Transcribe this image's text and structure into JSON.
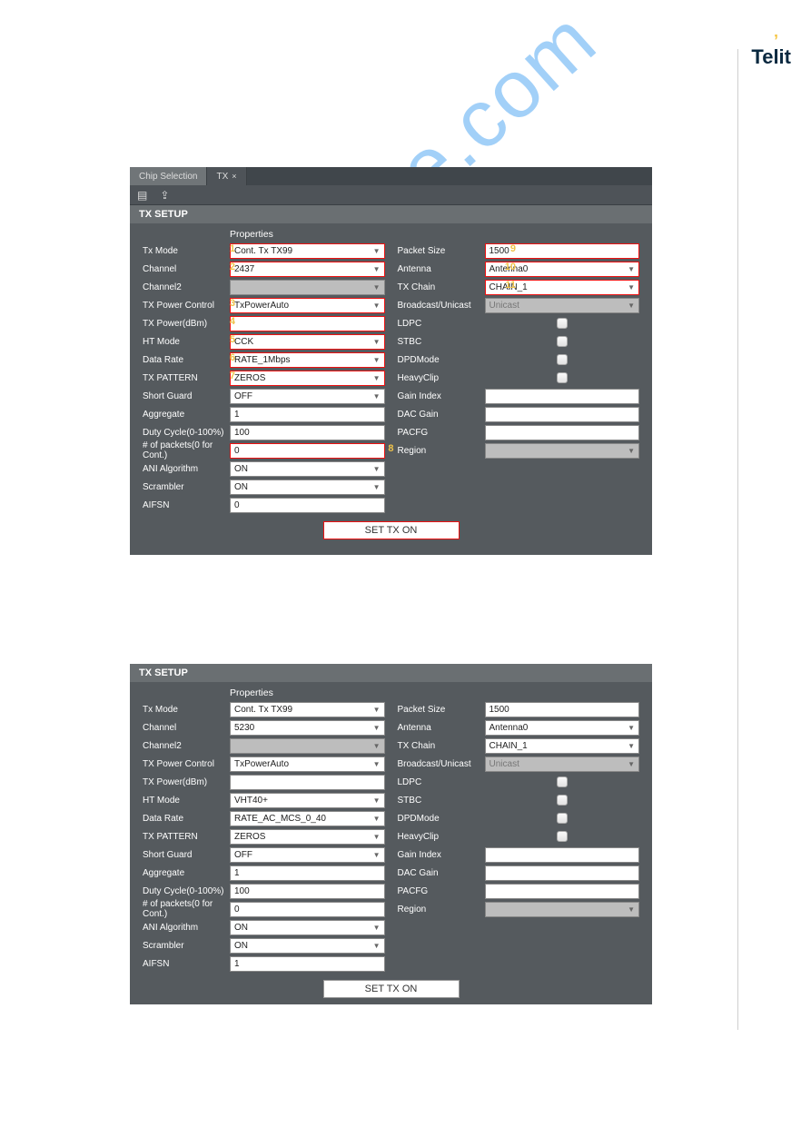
{
  "brand": "Telit",
  "watermark": "ualshive.com",
  "tabs": {
    "chip": "Chip Selection",
    "tx": "TX"
  },
  "section_title": "TX SETUP",
  "props_header": "Properties",
  "button": "SET TX ON",
  "labels_left": {
    "tx_mode": "Tx Mode",
    "channel": "Channel",
    "channel2": "Channel2",
    "tx_power_control": "TX Power Control",
    "tx_power_dbm": "TX Power(dBm)",
    "ht_mode": "HT Mode",
    "data_rate": "Data Rate",
    "tx_pattern": "TX PATTERN",
    "short_guard": "Short Guard",
    "aggregate": "Aggregate",
    "duty_cycle": "Duty Cycle(0-100%)",
    "num_packets": "# of packets(0 for Cont.)",
    "ani": "ANI Algorithm",
    "scrambler": "Scrambler",
    "aifsn": "AIFSN"
  },
  "labels_right": {
    "packet_size": "Packet Size",
    "antenna": "Antenna",
    "tx_chain": "TX Chain",
    "broadcast": "Broadcast/Unicast",
    "ldpc": "LDPC",
    "stbc": "STBC",
    "dpd": "DPDMode",
    "heavy": "HeavyClip",
    "gain_index": "Gain Index",
    "dac_gain": "DAC Gain",
    "pacfg": "PACFG",
    "region": "Region"
  },
  "panel1": {
    "left": {
      "tx_mode": "Cont. Tx TX99",
      "channel": "2437",
      "channel2": "",
      "tx_power_control": "TxPowerAuto",
      "tx_power_dbm": "",
      "ht_mode": "CCK",
      "data_rate": "RATE_1Mbps",
      "tx_pattern": "ZEROS",
      "short_guard": "OFF",
      "aggregate": "1",
      "duty_cycle": "100",
      "num_packets": "0",
      "ani": "ON",
      "scrambler": "ON",
      "aifsn": "0"
    },
    "right": {
      "packet_size": "1500",
      "antenna": "Antenna0",
      "tx_chain": "CHAIN_1",
      "broadcast": "Unicast",
      "gain_index": "",
      "dac_gain": "",
      "pacfg": "",
      "region": ""
    },
    "markers": {
      "m1": "1",
      "m2": "2",
      "m3": "3",
      "m4": "4",
      "m5": "5",
      "m6": "6",
      "m7": "7",
      "m8": "8",
      "m9": "9",
      "m10": "10",
      "m11": "11"
    }
  },
  "panel2": {
    "left": {
      "tx_mode": "Cont. Tx TX99",
      "channel": "5230",
      "channel2": "",
      "tx_power_control": "TxPowerAuto",
      "tx_power_dbm": "",
      "ht_mode": "VHT40+",
      "data_rate": "RATE_AC_MCS_0_40",
      "tx_pattern": "ZEROS",
      "short_guard": "OFF",
      "aggregate": "1",
      "duty_cycle": "100",
      "num_packets": "0",
      "ani": "ON",
      "scrambler": "ON",
      "aifsn": "1"
    },
    "right": {
      "packet_size": "1500",
      "antenna": "Antenna0",
      "tx_chain": "CHAIN_1",
      "broadcast": "Unicast",
      "gain_index": "",
      "dac_gain": "",
      "pacfg": "",
      "region": ""
    }
  }
}
